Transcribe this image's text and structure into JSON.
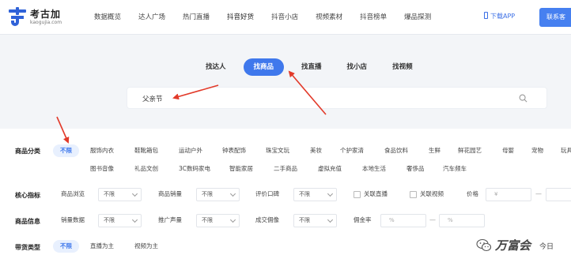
{
  "brand": {
    "title": "考古加",
    "subtitle": "kaogujia.com"
  },
  "nav": {
    "items": [
      "数据概览",
      "达人广场",
      "热门直播",
      "抖音好货",
      "抖音小店",
      "视频素材",
      "抖音榜单",
      "爆品探测"
    ],
    "download_label": "下载APP",
    "contact_label": "联系客"
  },
  "find_tabs": [
    "找达人",
    "找商品",
    "找直播",
    "找小店",
    "找视频"
  ],
  "search": {
    "value": "父亲节"
  },
  "filters": {
    "category": {
      "label": "商品分类",
      "row1": [
        "不限",
        "服饰内衣",
        "鞋靴箱包",
        "运动户外",
        "钟表配饰",
        "珠宝文玩",
        "美妆",
        "个护家清",
        "食品饮料",
        "生鲜",
        "鲜花园艺",
        "母婴",
        "宠物",
        "玩具"
      ],
      "row2": [
        "图书音像",
        "礼品文创",
        "3C数码家电",
        "智能家居",
        "二手商品",
        "虚拟充值",
        "本地生活",
        "奢侈品",
        "汽车频车"
      ]
    },
    "core": {
      "label": "核心指标",
      "views_label": "商品浏览",
      "views_value": "不限",
      "sales_label": "商品销量",
      "sales_value": "不限",
      "rating_label": "评价口碑",
      "rating_value": "不限",
      "live_label": "关联直播",
      "video_label": "关联视频",
      "price_label": "价格",
      "currency": "¥"
    },
    "info": {
      "label": "商品信息",
      "sales_data_label": "销量数据",
      "sales_data_value": "不限",
      "promo_label": "推广声量",
      "promo_value": "不限",
      "conversion_label": "成交佣像",
      "conversion_value": "不限",
      "commission_label": "佣金率",
      "percent": "%"
    },
    "type": {
      "label": "带货类型",
      "options": [
        "不限",
        "直播为主",
        "视频为主"
      ]
    }
  },
  "watermark": {
    "text": "万富会",
    "tail": "今日"
  },
  "colors": {
    "accent": "#3f78ec",
    "arrow": "#e23a2a"
  }
}
